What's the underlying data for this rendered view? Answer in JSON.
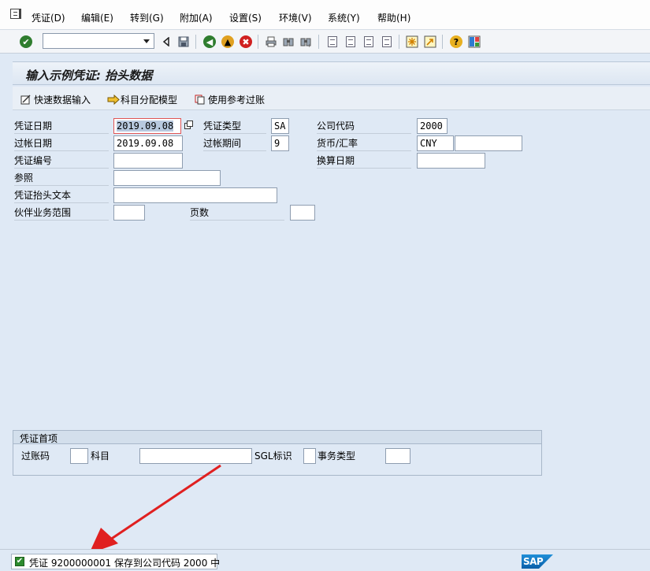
{
  "menu": {
    "items": [
      {
        "label": "凭证(D)"
      },
      {
        "label": "编辑(E)"
      },
      {
        "label": "转到(G)"
      },
      {
        "label": "附加(A)"
      },
      {
        "label": "设置(S)"
      },
      {
        "label": "环境(V)"
      },
      {
        "label": "系统(Y)"
      },
      {
        "label": "帮助(H)"
      }
    ]
  },
  "toolbar": {
    "command_field_value": "",
    "icons": [
      "enter-check-icon",
      "back-triangle-icon",
      "save-icon",
      "back-icon",
      "exit-icon",
      "cancel-icon",
      "print-icon",
      "find-icon",
      "find-next-icon",
      "first-page-icon",
      "previous-page-icon",
      "next-page-icon",
      "last-page-icon",
      "create-session-icon",
      "shortcut-icon",
      "help-icon",
      "customize-layout-icon"
    ]
  },
  "title": "输入示例凭证: 抬头数据",
  "app_toolbar": {
    "fast_entry": "快速数据输入",
    "account_model": "科目分配模型",
    "post_with_reference": "使用参考过账"
  },
  "header": {
    "doc_date_label": "凭证日期",
    "doc_date_value": "2019.09.08",
    "doc_type_label": "凭证类型",
    "doc_type_value": "SA",
    "company_code_label": "公司代码",
    "company_code_value": "2000",
    "posting_date_label": "过帐日期",
    "posting_date_value": "2019.09.08",
    "period_label": "过帐期间",
    "period_value": "9",
    "currency_label": "货币/汇率",
    "currency_value": "CNY",
    "exchange_rate_value": "",
    "doc_number_label": "凭证编号",
    "doc_number_value": "",
    "translation_date_label": "换算日期",
    "translation_date_value": "",
    "reference_label": "参照",
    "reference_value": "",
    "header_text_label": "凭证抬头文本",
    "header_text_value": "",
    "trading_partner_label": "伙伴业务范围",
    "trading_partner_value": "",
    "page_label": "页数",
    "page_value": ""
  },
  "first_line_item": {
    "title": "凭证首项",
    "posting_key_label": "过账码",
    "posting_key_value": "",
    "account_label": "科目",
    "account_value": "",
    "sgl_label": "SGL标识",
    "sgl_value": "",
    "transaction_type_label": "事务类型",
    "transaction_type_value": ""
  },
  "status": {
    "message": "凭证 9200000001 保存到公司代码 2000 中",
    "type": "success"
  },
  "colors": {
    "background": "#dfe9f5",
    "status_success": "#2e8b2e",
    "annotation_arrow": "#e02020",
    "sap_blue": "#0a6fc2"
  }
}
